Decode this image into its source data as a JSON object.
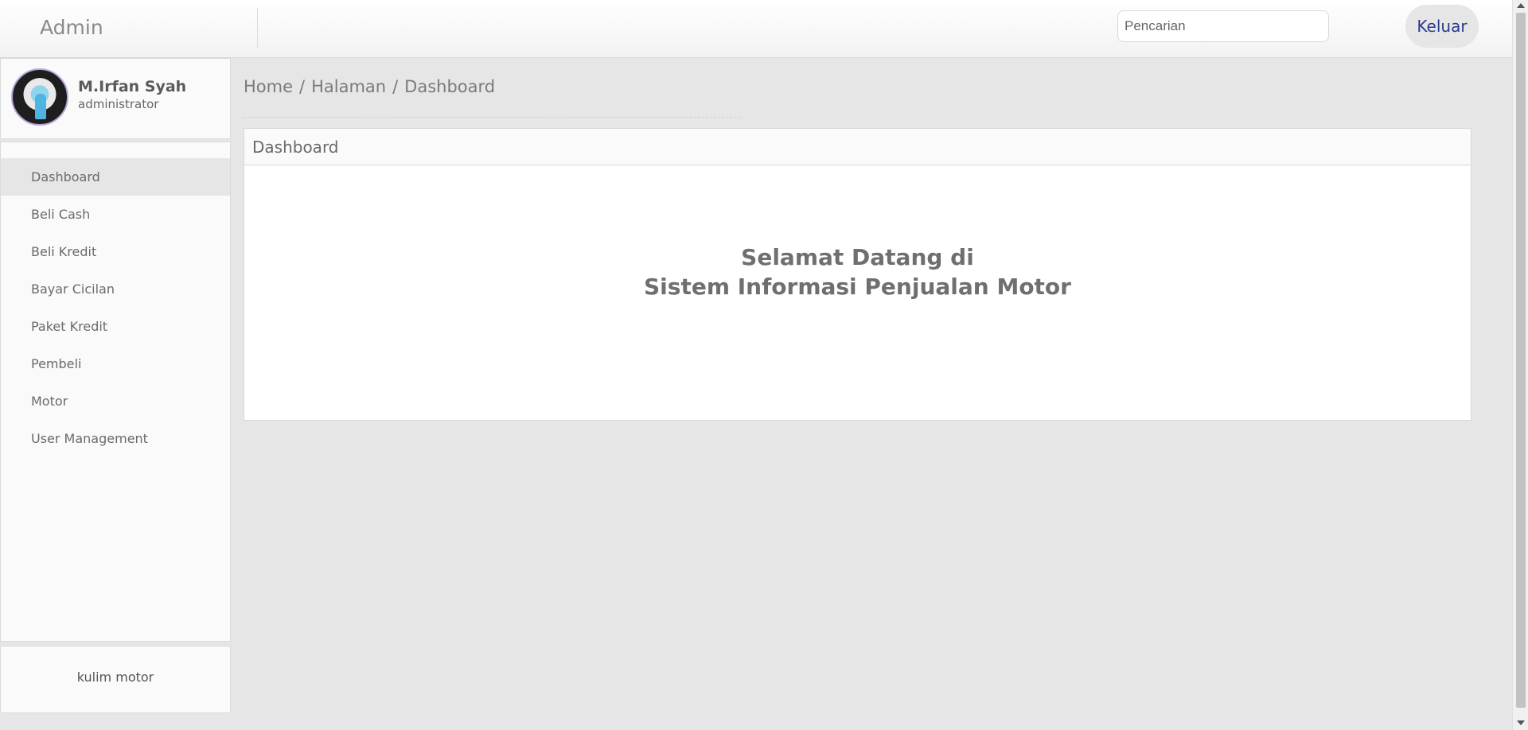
{
  "header": {
    "brand": "Admin",
    "search_placeholder": "Pencarian",
    "logout_label": "Keluar"
  },
  "profile": {
    "name": "M.Irfan Syah",
    "role": "administrator"
  },
  "sidebar": {
    "items": [
      {
        "label": "Dashboard",
        "active": true
      },
      {
        "label": "Beli Cash"
      },
      {
        "label": "Beli Kredit"
      },
      {
        "label": "Bayar Cicilan"
      },
      {
        "label": "Paket Kredit"
      },
      {
        "label": "Pembeli"
      },
      {
        "label": "Motor"
      },
      {
        "label": "User Management"
      }
    ],
    "footer": "kulim motor"
  },
  "breadcrumb": {
    "items": [
      "Home",
      "Halaman",
      "Dashboard"
    ],
    "separator": "/"
  },
  "panel": {
    "title": "Dashboard",
    "welcome_line1": "Selamat Datang di",
    "welcome_line2": "Sistem Informasi Penjualan Motor"
  }
}
